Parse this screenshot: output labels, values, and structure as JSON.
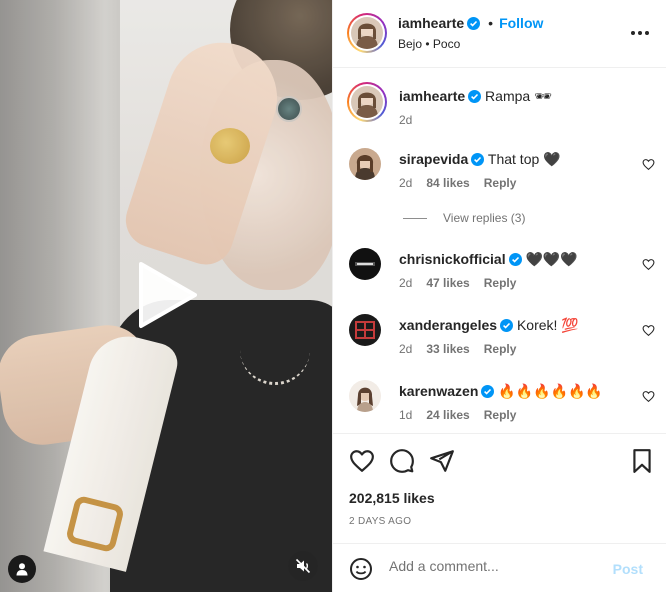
{
  "header": {
    "username": "iamhearte",
    "separator": "•",
    "follow_label": "Follow",
    "location": "Bejo • Poco"
  },
  "caption": {
    "username": "iamhearte",
    "text": "Rampa 🕶",
    "age": "2d"
  },
  "comments": [
    {
      "username": "sirapevida",
      "text": "That top 🖤",
      "age": "2d",
      "likes": "84 likes",
      "reply": "Reply",
      "verified": true
    },
    {
      "username": "chrisnickofficial",
      "text": "🖤🖤🖤",
      "age": "2d",
      "likes": "47 likes",
      "reply": "Reply",
      "verified": true
    },
    {
      "username": "xanderangeles",
      "text": "Korek! 💯",
      "age": "2d",
      "likes": "33 likes",
      "reply": "Reply",
      "verified": true
    },
    {
      "username": "karenwazen",
      "text": "🔥🔥🔥🔥🔥🔥",
      "age": "1d",
      "likes": "24 likes",
      "reply": "Reply",
      "verified": true
    }
  ],
  "view_replies": "View replies (3)",
  "post": {
    "likes": "202,815 likes",
    "date": "2 DAYS AGO"
  },
  "add_comment": {
    "placeholder": "Add a comment...",
    "post_label": "Post"
  },
  "icons": {
    "play": "play-icon",
    "user_tag": "user-tag-icon",
    "mute": "speaker-muted-icon",
    "more": "more-options-icon",
    "heart": "heart-icon",
    "comment": "comment-icon",
    "share": "send-icon",
    "save": "bookmark-icon",
    "emoji": "emoji-icon"
  },
  "colors": {
    "follow": "#0095f6",
    "post_disabled": "#b2dffc",
    "verified": "#0095f6"
  }
}
